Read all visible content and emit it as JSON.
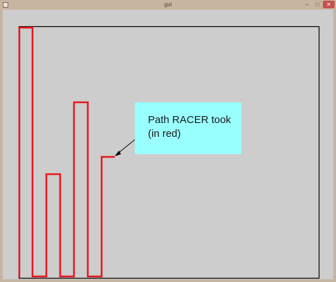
{
  "window": {
    "title": "gui",
    "controls": {
      "minimize": "–",
      "maximize": "□",
      "close": "✕"
    },
    "app_icon": "app-icon"
  },
  "annotation": {
    "line1": "Path RACER took",
    "line2": "(in red)",
    "background": "#99ffff"
  },
  "colors": {
    "path": "#e8151d",
    "frame": "#000000",
    "canvas": "#cdcdcd"
  }
}
